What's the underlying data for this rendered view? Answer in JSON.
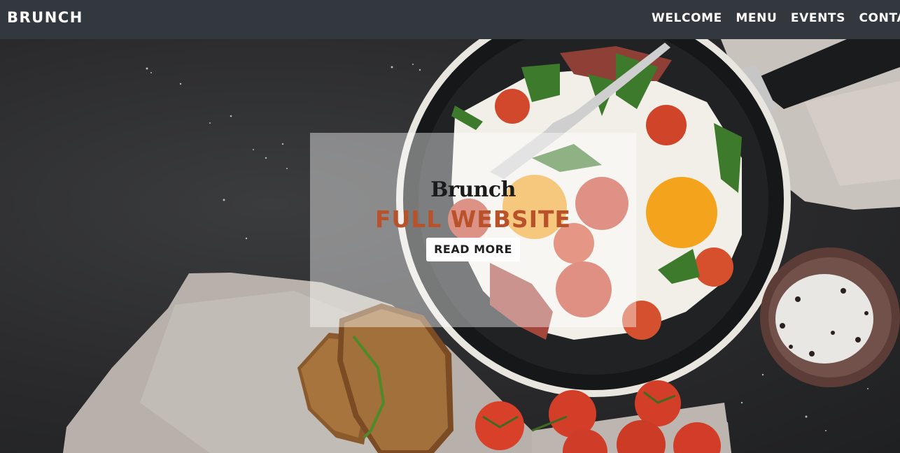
{
  "header": {
    "brand": "BRUNCH",
    "nav": [
      "WELCOME",
      "MENU",
      "EVENTS",
      "CONTACT"
    ]
  },
  "hero": {
    "script_text": "Brunch",
    "title": "FULL WEBSITE",
    "button_label": "READ MORE"
  },
  "colors": {
    "topbar": "#33373e",
    "title_accent": "#b9512b",
    "button_bg": "#ffffff"
  }
}
